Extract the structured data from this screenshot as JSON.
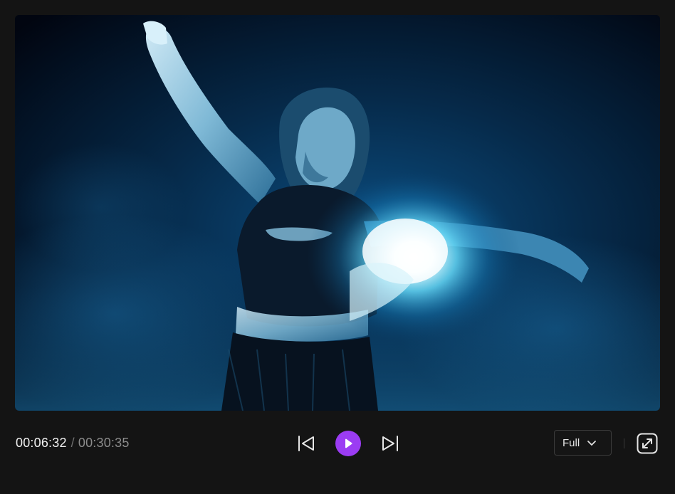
{
  "player": {
    "time": {
      "current": "00:06:32",
      "separator": "/",
      "total": "00:30:35"
    },
    "transport": {
      "previous_icon": "skip-previous-icon",
      "play_icon": "play-icon",
      "next_icon": "skip-next-icon"
    },
    "zoom": {
      "selected": "Full",
      "icon": "chevron-down-icon"
    },
    "fullscreen_icon": "expand-diagonal-icon",
    "colors": {
      "background": "#141414",
      "accent": "#9b3cf3",
      "video_tint": "#0a4a7a"
    }
  }
}
